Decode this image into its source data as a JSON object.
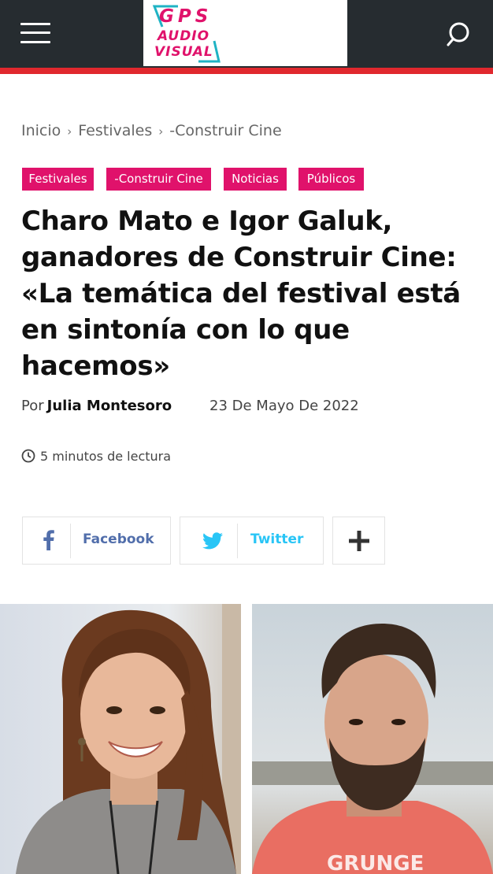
{
  "header": {
    "menu_icon": "hamburger-menu-icon",
    "search_icon": "search-icon",
    "logo": {
      "line1": "GPS",
      "line2": "AUDIO",
      "line3": "VISUAL",
      "color": "#e0126b"
    },
    "bar_color": "#262c30",
    "accent_color": "#e0282e"
  },
  "breadcrumb": {
    "items": [
      "Inicio",
      "Festivales",
      "-Construir Cine"
    ],
    "separator": "›"
  },
  "tags": [
    {
      "label": "Festivales"
    },
    {
      "label": "-Construir Cine"
    },
    {
      "label": "Noticias"
    },
    {
      "label": "Públicos"
    }
  ],
  "tag_color": "#e0126b",
  "article": {
    "title_lines": [
      "Charo Mato e Igor Galuk,",
      "ganadores de Construir Cine:",
      "«La temática del festival está",
      "en sintonía con lo que",
      "hacemos»"
    ],
    "by_prefix": "Por",
    "author": "Julia Montesoro",
    "date": "23 De Mayo De 2022",
    "read_time": "5 minutos de lectura"
  },
  "share": {
    "facebook_label": "Facebook",
    "twitter_label": "Twitter",
    "facebook_color": "#516eab",
    "twitter_color": "#29c5f6",
    "more_icon": "plus-icon"
  },
  "photos": [
    {
      "subject": "woman-portrait"
    },
    {
      "subject": "man-portrait"
    }
  ]
}
